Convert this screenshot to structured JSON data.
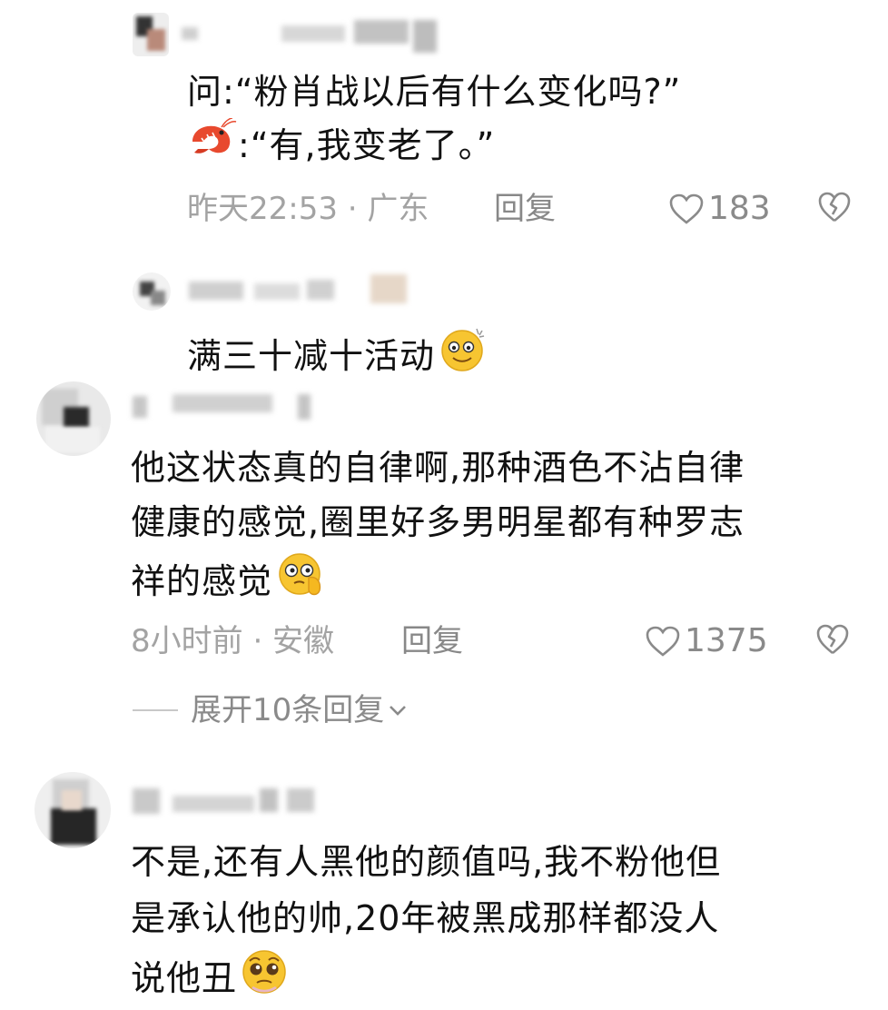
{
  "comments": [
    {
      "question_prefix": "问:",
      "question": "“粉肖战以后有什么变化吗?”",
      "answer_prefix": ":",
      "answer": "“有,我变老了。”",
      "time_loc": "昨天22:53 · 广东",
      "reply_label": "回复",
      "likes": "183",
      "answer_icon": "shrimp-icon"
    },
    {
      "text": "满三十减十活动",
      "emoji": "sweat-smile-emoji"
    },
    {
      "line1": "他这状态真的自律啊,那种酒色不沾自律",
      "line2": "健康的感觉,圈里好多男明星都有种罗志",
      "line3": "祥的感觉",
      "emoji": "thinking-emoji",
      "time_loc": "8小时前 · 安徽",
      "reply_label": "回复",
      "likes": "1375",
      "expand_label": "展开10条回复"
    },
    {
      "line1": "不是,还有人黑他的颜值吗,我不粉他但",
      "line2": "是承认他的帅,20年被黑成那样都没人",
      "line3": "说他丑",
      "emoji": "pleading-emoji"
    }
  ],
  "colors": {
    "meta": "#a3a3a3",
    "text": "#111111",
    "shrimp": "#e8492e",
    "emoji": "#f7c531"
  }
}
